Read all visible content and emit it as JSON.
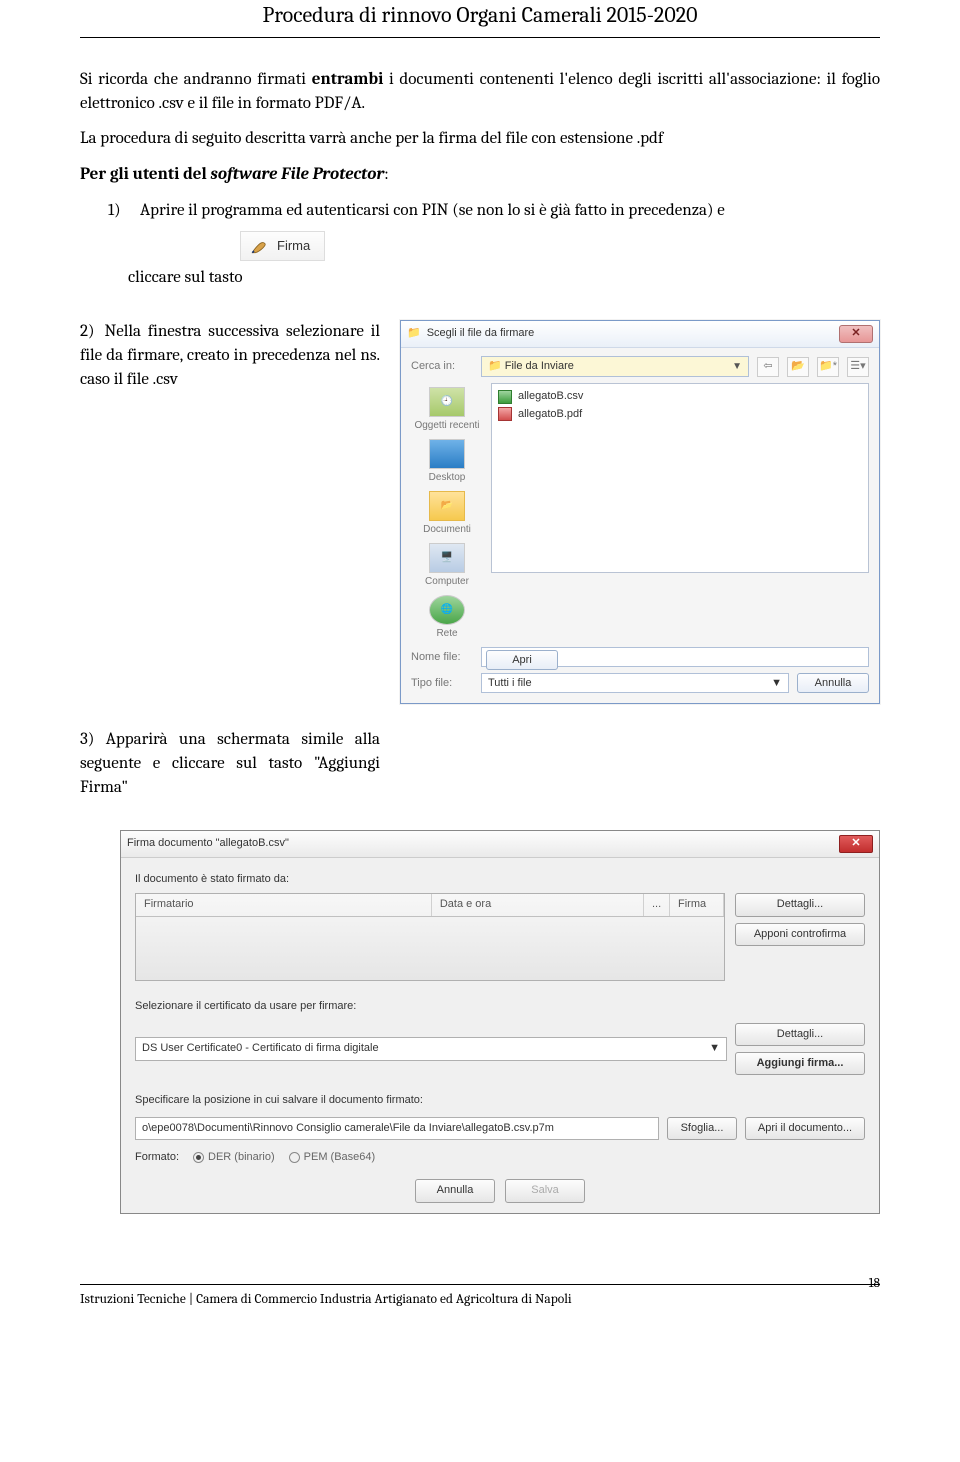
{
  "header": {
    "title": "Procedura di rinnovo Organi Camerali 2015-2020"
  },
  "intro": {
    "p1a": "Si ricorda che andranno firmati ",
    "p1b": "entrambi",
    "p1c": " i documenti contenenti l'elenco degli iscritti all'associazione: il foglio elettronico .csv e il file in formato PDF/A.",
    "p2": "La procedura di seguito descritta varrà anche per la firma del file con estensione .pdf",
    "p3a": "Per gli utenti del ",
    "p3b": "software File Protector",
    "p3c": ":"
  },
  "step1": {
    "num": "1)",
    "text": "Aprire il programma ed autenticarsi con PIN (se non lo si è già fatto in precedenza) e",
    "clicktext": "cliccare sul tasto",
    "firma_label": "Firma"
  },
  "step2": {
    "num": "2)",
    "text": "Nella finestra successiva selezionare il file da firmare, creato in precedenza nel ns. caso il file .csv"
  },
  "file_dialog": {
    "title": "Scegli il file da firmare",
    "search_in_label": "Cerca in:",
    "folder": "File da Inviare",
    "places": {
      "recent": "Oggetti recenti",
      "desktop": "Desktop",
      "documents": "Documenti",
      "computer": "Computer",
      "network": "Rete"
    },
    "files": [
      {
        "icon": "xls",
        "name": "allegatoB.csv"
      },
      {
        "icon": "pdf",
        "name": "allegatoB.pdf"
      }
    ],
    "filename_label": "Nome file:",
    "filetype_label": "Tipo file:",
    "filetype_value": "Tutti i file",
    "open": "Apri",
    "cancel": "Annulla"
  },
  "step3": {
    "text": "3) Apparirà una schermata simile alla seguente e cliccare sul tasto \"Aggiungi Firma\""
  },
  "sign_dialog": {
    "title": "Firma documento \"allegatoB.csv\"",
    "signed_by_label": "Il documento è stato firmato da:",
    "grid": {
      "col1": "Firmatario",
      "col2": "Data e ora",
      "col3": "...",
      "col4": "Firma"
    },
    "details": "Dettagli...",
    "countersign": "Apponi controfirma",
    "cert_label": "Selezionare il certificato da usare per firmare:",
    "cert_value": "DS User Certificate0 - Certificato di firma digitale",
    "add_sign": "Aggiungi firma...",
    "save_label": "Specificare la posizione in cui salvare il documento firmato:",
    "save_path": "o\\epe0078\\Documenti\\Rinnovo Consiglio camerale\\File da Inviare\\allegatoB.csv.p7m",
    "browse": "Sfoglia...",
    "open_doc": "Apri il documento...",
    "format_label": "Formato:",
    "format_der": "DER (binario)",
    "format_pem": "PEM (Base64)",
    "cancel": "Annulla",
    "save": "Salva"
  },
  "footer": {
    "left": "Istruzioni Tecniche | Camera di Commercio Industria Artigianato ed Agricoltura di Napoli",
    "page": "18"
  }
}
